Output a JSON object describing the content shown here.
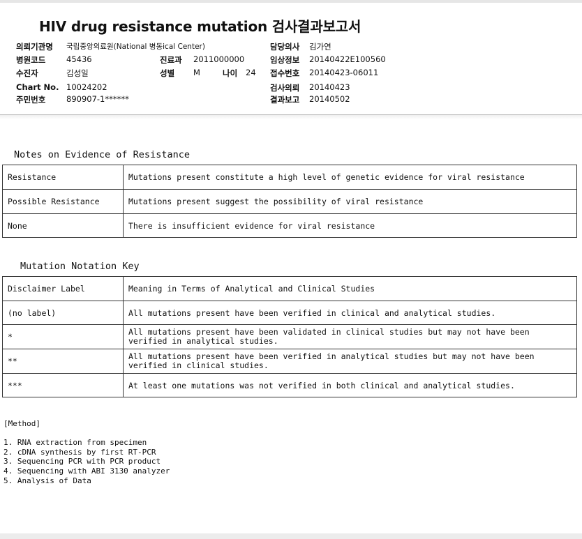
{
  "report": {
    "title": "HIV drug resistance mutation 검사결과보고서",
    "fields": {
      "institution": {
        "label": "의뢰기관명",
        "value": "국립중앙의료원(National 병동ical Center)"
      },
      "doctor": {
        "label": "담당의사",
        "value": "김가연"
      },
      "hospital_code": {
        "label": "병원코드",
        "value": "45436"
      },
      "department": {
        "label": "진료과",
        "value": "2011000000"
      },
      "clinical_info": {
        "label": "임상정보",
        "value": "20140422E100560"
      },
      "patient": {
        "label": "수진자",
        "value": "김성일"
      },
      "sex": {
        "label": "성별",
        "value": "M"
      },
      "age": {
        "label": "나이",
        "value": "24"
      },
      "receipt_no": {
        "label": "접수번호",
        "value": "20140423-06011"
      },
      "chart_no": {
        "label": "Chart No.",
        "value": "10024202"
      },
      "test_request": {
        "label": "검사의뢰",
        "value": "20140423"
      },
      "resident_no": {
        "label": "주민번호",
        "value": "890907-1******"
      },
      "result_report": {
        "label": "결과보고",
        "value": "20140502"
      }
    }
  },
  "evidence": {
    "title": "Notes on Evidence of Resistance",
    "rows": [
      {
        "term": "Resistance",
        "desc": "Mutations present  constitute a high level of genetic evidence for viral resistance"
      },
      {
        "term": "Possible Resistance",
        "desc": "Mutations present suggest the possibility of viral resistance"
      },
      {
        "term": "None",
        "desc": "There is insufficient evidence for viral resistance"
      }
    ]
  },
  "notation": {
    "title": "Mutation Notation Key",
    "header": {
      "label": "Disclaimer Label",
      "meaning": "Meaning in Terms of Analytical and Clinical Studies"
    },
    "rows": [
      {
        "label": "(no label)",
        "meaning": "All mutations present have been verified in clinical and analytical studies."
      },
      {
        "label": "*",
        "meaning": "All mutations present have been  validated in clinical studies but may not have been verified in analytical studies."
      },
      {
        "label": "**",
        "meaning": "All mutations present have been verified in analytical studies but may not have been verified in clinical studies."
      },
      {
        "label": "***",
        "meaning": "At least one mutations was not verified in both clinical and analytical studies."
      }
    ]
  },
  "method": {
    "title": "[Method]",
    "steps": [
      "1. RNA extraction from specimen",
      "2. cDNA synthesis by first RT-PCR",
      "3. Sequencing PCR with PCR product",
      "4. Sequencing with ABI 3130 analyzer",
      "5. Analysis of Data"
    ]
  }
}
